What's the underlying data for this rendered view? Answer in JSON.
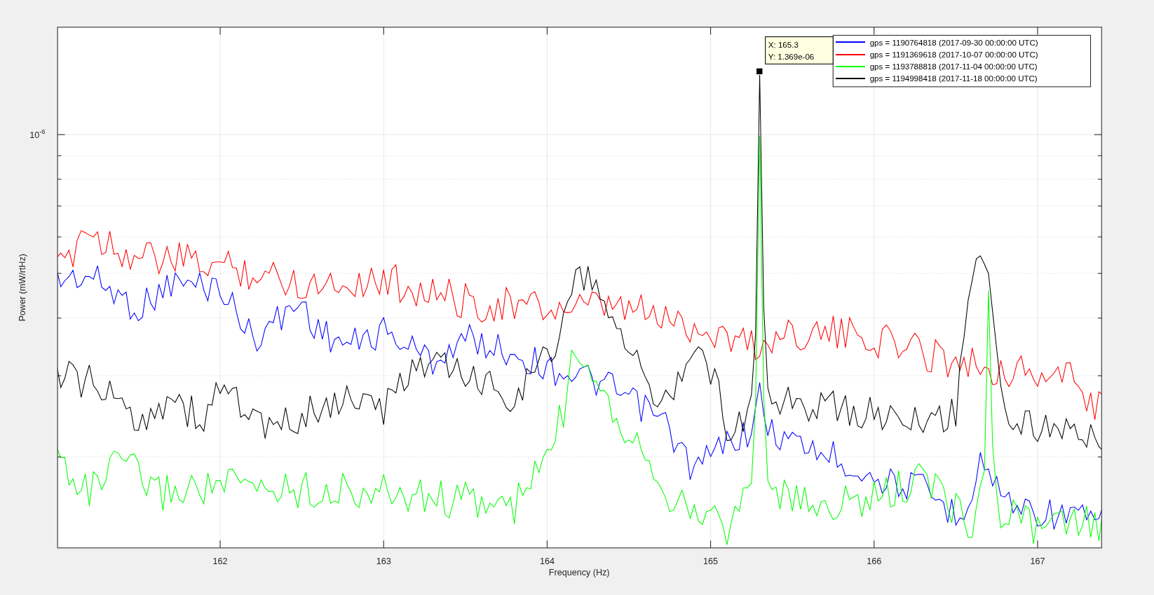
{
  "figure": {
    "axes": {
      "xlabel": "Frequency (Hz)",
      "ylabel": "Power (mW/rtHz)",
      "xticks": [
        "162",
        "163",
        "164",
        "165",
        "166",
        "167"
      ],
      "ytick": {
        "base": "10",
        "exponent": "-6"
      }
    },
    "legend": [
      {
        "label": "gps = 1190764818 (2017-09-30 00:00:00 UTC)",
        "color": "#0000ff"
      },
      {
        "label": "gps = 1191369618 (2017-10-07 00:00:00 UTC)",
        "color": "#ff0000"
      },
      {
        "label": "gps = 1193788818 (2017-11-04 00:00:00 UTC)",
        "color": "#00ff00"
      },
      {
        "label": "gps = 1194998418 (2017-11-18 00:00:00 UTC)",
        "color": "#000000"
      }
    ],
    "datatip": {
      "x_text": "X: 165.3",
      "y_text": "Y: 1.369e-06"
    }
  }
}
